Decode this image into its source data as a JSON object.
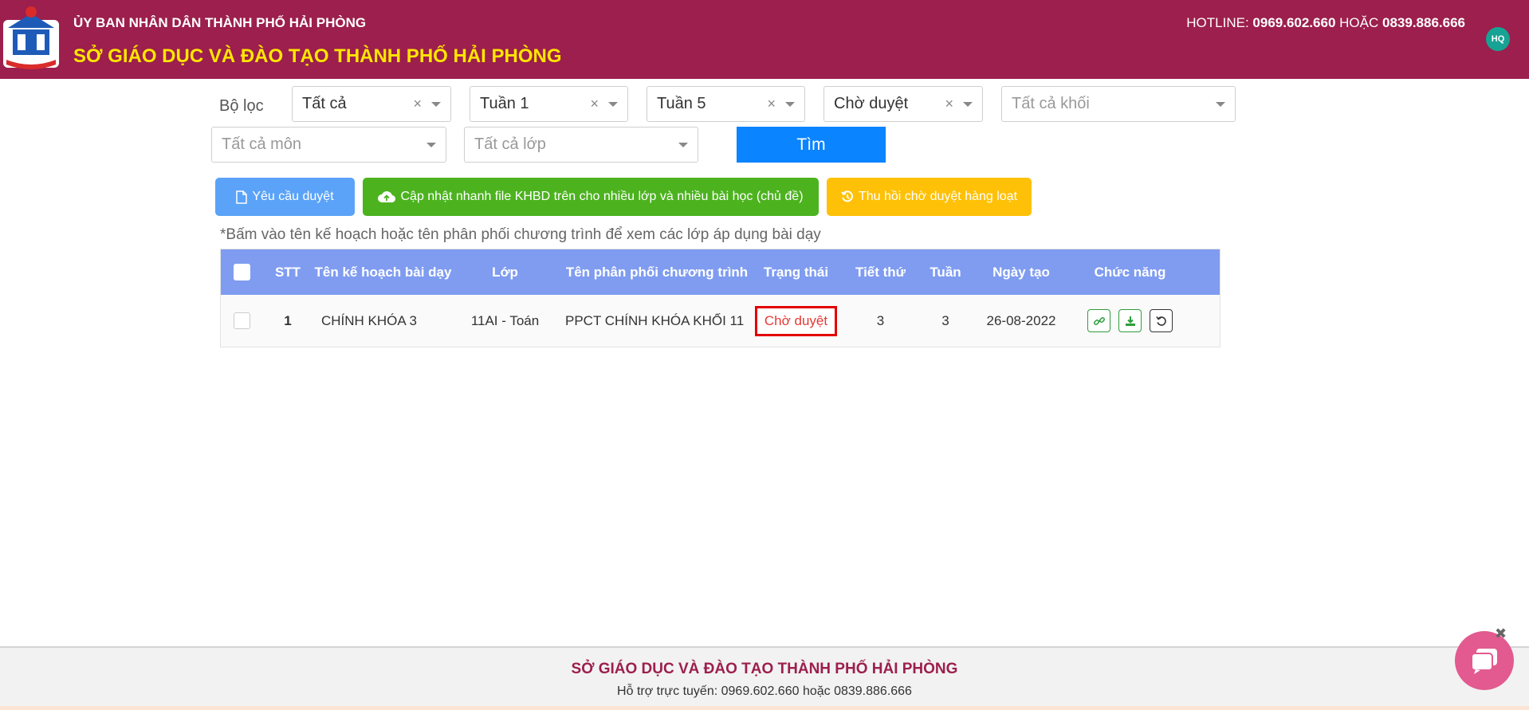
{
  "header": {
    "org_line": "ỦY BAN NHÂN DÂN THÀNH PHỐ HẢI PHÒNG",
    "dept_title": "SỞ GIÁO DỤC VÀ ĐÀO TẠO THÀNH PHỐ HẢI PHÒNG",
    "hotline_label": "HOTLINE:",
    "hotline_1": "0969.602.660",
    "hotline_or": "HOẶC",
    "hotline_2": "0839.886.666",
    "avatar_initials": "HQ"
  },
  "filters": {
    "label": "Bộ lọc",
    "status_all": "Tất cả",
    "week_from": "Tuần 1",
    "week_to": "Tuần 5",
    "approval": "Chờ duyệt",
    "grade_placeholder": "Tất cả khối",
    "subject_placeholder": "Tất cả môn",
    "class_placeholder": "Tất cả lớp",
    "search_button": "Tìm"
  },
  "actions": {
    "request_approval": "Yêu cầu duyệt",
    "bulk_update": "Cập nhật nhanh file KHBD trên cho nhiều lớp và nhiều bài học (chủ đề)",
    "bulk_revoke": "Thu hồi chờ duyệt hàng loạt"
  },
  "note": "*Bấm vào tên kế hoạch hoặc tên phân phối chương trình để xem các lớp áp dụng bài dạy",
  "table": {
    "headers": {
      "stt": "STT",
      "plan_name": "Tên kế hoạch bài dạy",
      "class": "Lớp",
      "ppct_name": "Tên phân phối chương trình",
      "status": "Trạng thái",
      "period": "Tiết thứ",
      "week": "Tuần",
      "created": "Ngày tạo",
      "functions": "Chức năng"
    },
    "rows": [
      {
        "stt": "1",
        "plan_name": "CHÍNH KHÓA 3",
        "class": "11AI - Toán",
        "ppct_name": "PPCT CHÍNH KHÓA KHỐI 11",
        "status": "Chờ duyệt",
        "period": "3",
        "week": "3",
        "created": "26-08-2022"
      }
    ]
  },
  "footer": {
    "title": "SỞ GIÁO DỤC VÀ ĐÀO TẠO THÀNH PHỐ HẢI PHÒNG",
    "support": "Hỗ trợ trực tuyến: 0969.602.660 hoặc 0839.886.666"
  },
  "colors": {
    "header_bg": "#9c1f4d",
    "title_yellow": "#ffe600",
    "table_header": "#7f9cf0",
    "search_blue": "#0a84ff",
    "status_red": "#e30000"
  },
  "icons": [
    "logo-emblem",
    "file-icon",
    "cloud-upload-icon",
    "history-icon",
    "link-icon",
    "download-icon",
    "undo-icon",
    "chat-icon",
    "close-icon"
  ]
}
